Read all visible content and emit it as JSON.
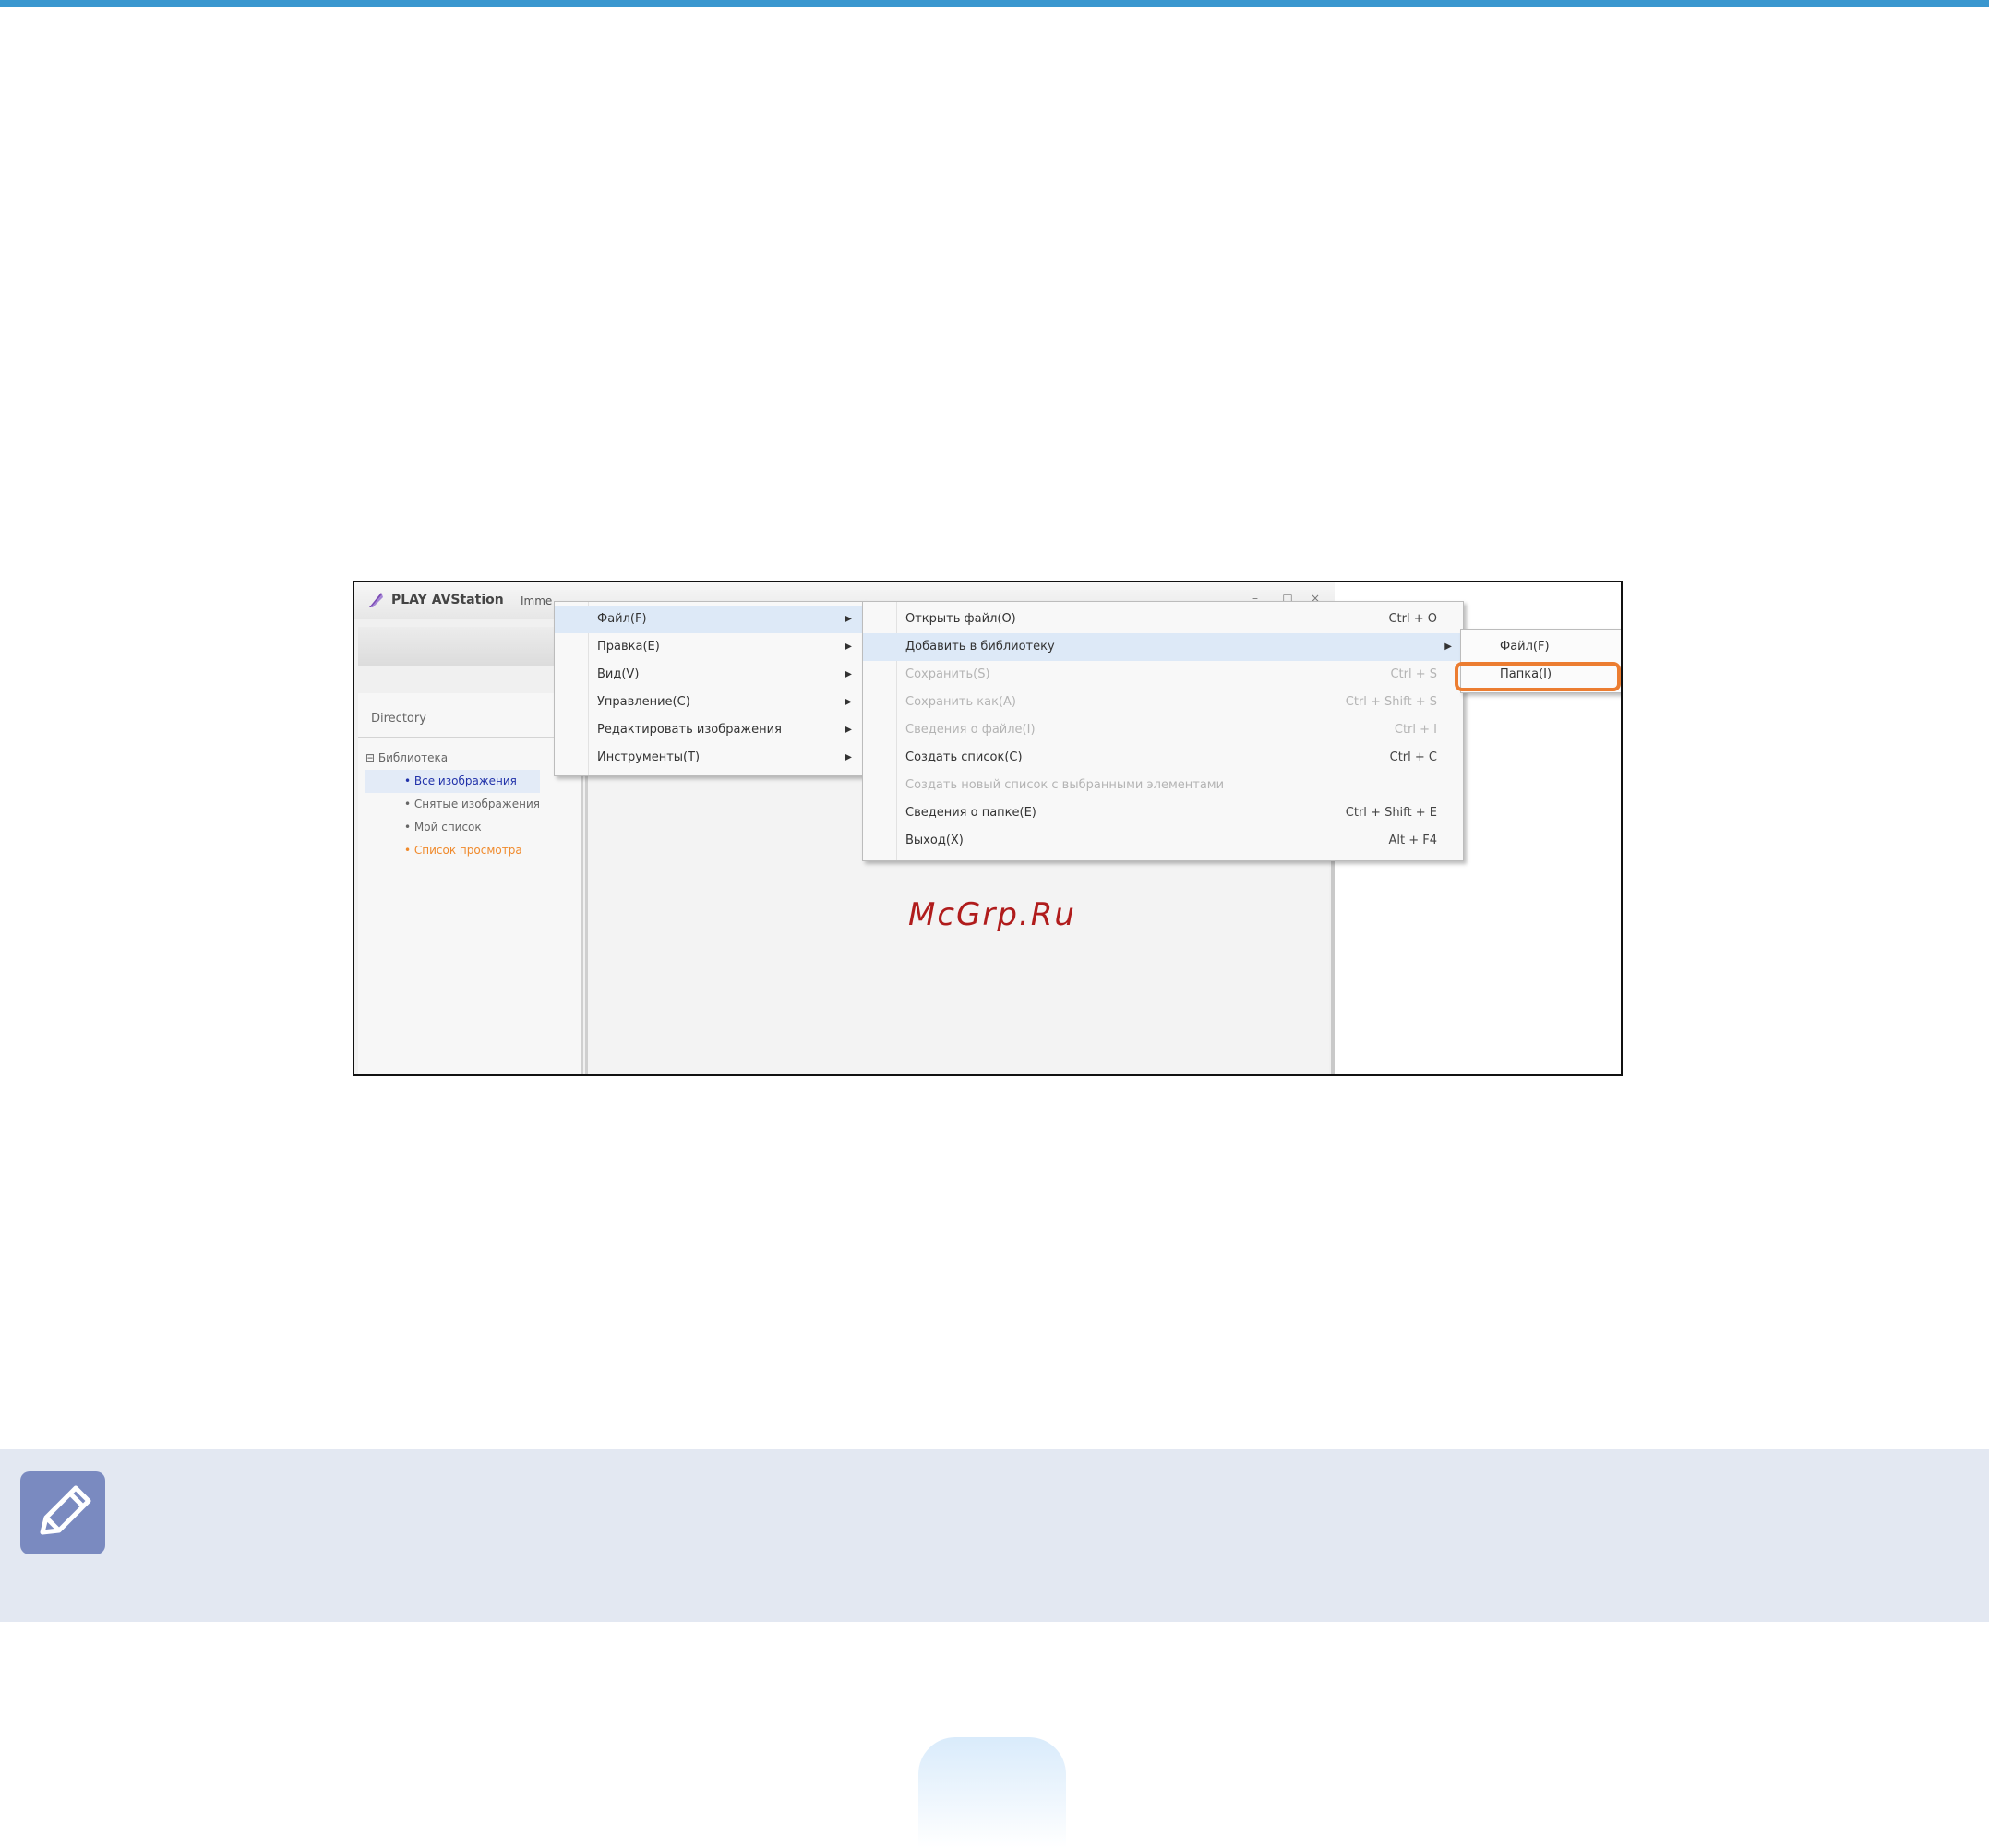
{
  "screenshot": {
    "app_title": "PLAY AVStation",
    "menu_stub": "Imme",
    "window_buttons": [
      "–",
      "□",
      "×"
    ],
    "directory_label": "Directory",
    "tree": {
      "root": "Библиотека",
      "children": [
        "Все изображения",
        "Снятые изображения",
        "Мой список",
        "Список просмотра"
      ]
    },
    "menu_level1": [
      {
        "label": "Файл(F)"
      },
      {
        "label": "Правка(E)"
      },
      {
        "label": "Вид(V)"
      },
      {
        "label": "Управление(C)"
      },
      {
        "label": "Редактировать изображения"
      },
      {
        "label": "Инструменты(T)"
      }
    ],
    "menu_level2": [
      {
        "label": "Открыть файл(O)",
        "shortcut": "Ctrl + O"
      },
      {
        "label": "Добавить в библиотеку",
        "shortcut": ""
      },
      {
        "label": "Сохранить(S)",
        "shortcut": "Ctrl + S"
      },
      {
        "label": "Сохранить как(A)",
        "shortcut": "Ctrl + Shift + S"
      },
      {
        "label": "Сведения о файле(I)",
        "shortcut": "Ctrl + I"
      },
      {
        "label": "Создать список(C)",
        "shortcut": "Ctrl + C"
      },
      {
        "label": "Создать новый список с выбранными элементами",
        "shortcut": ""
      },
      {
        "label": "Сведения о папке(E)",
        "shortcut": "Ctrl + Shift + E"
      },
      {
        "label": "Выход(X)",
        "shortcut": "Alt + F4"
      }
    ],
    "menu_level3": [
      {
        "label": "Файл(F)"
      },
      {
        "label": "Папка(I)"
      }
    ]
  },
  "watermark": "McGrp.Ru",
  "icons": {
    "note": "note-pencil-icon",
    "app_logo": "feather-icon"
  },
  "colors": {
    "top_rule": "#3a97cf",
    "highlight": "#ec7d31",
    "note_band": "#e3e8f2",
    "note_icon": "#7a8ac0",
    "watermark": "#b01c1c"
  }
}
